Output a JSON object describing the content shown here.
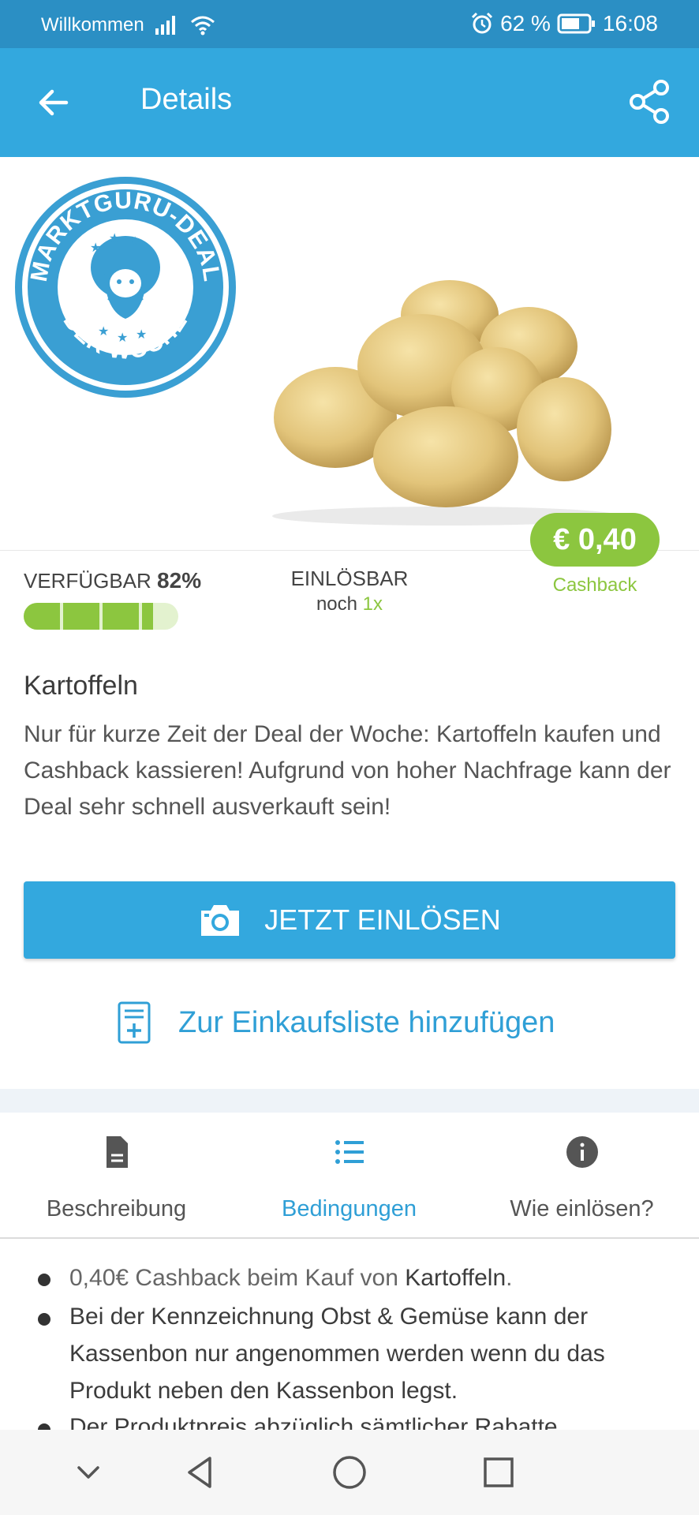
{
  "status_bar": {
    "carrier": "Willkommen",
    "battery": "62 %",
    "time": "16:08"
  },
  "app_bar": {
    "title": "Details"
  },
  "badge": {
    "text_top": "MARKTGURU-DEAL",
    "text_bottom": "DER WOCHE"
  },
  "deal": {
    "price": "€ 0,40",
    "cashback_label": "Cashback",
    "available_label": "VERFÜGBAR",
    "available_value": "82%",
    "available_fraction": 0.82,
    "redeemable_label": "EINLÖSBAR",
    "redeemable_prefix": "noch",
    "redeemable_count": "1x"
  },
  "product": {
    "title": "Kartoffeln",
    "description": "Nur für kurze Zeit der Deal der Woche: Kartoffeln kaufen und Cashback kassieren! Aufgrund von hoher Nachfrage kann der Deal sehr schnell ausverkauft sein!"
  },
  "actions": {
    "redeem_label": "JETZT EINLÖSEN",
    "add_to_list_label": "Zur Einkaufsliste hinzufügen"
  },
  "tabs": [
    {
      "label": "Beschreibung",
      "active": false
    },
    {
      "label": "Bedingungen",
      "active": true
    },
    {
      "label": "Wie einlösen?",
      "active": false
    }
  ],
  "conditions": {
    "item1_prefix": "0,40€ Cashback beim Kauf von ",
    "item1_product": "Kartoffeln",
    "item1_suffix": ".",
    "item2": "Bei der Kennzeichnung  Obst & Gemüse  kann der Kassenbon nur angenommen werden wenn du das Produkt neben den Kassenbon legst.",
    "item3": "Der Produktpreis abzüglich sämtlicher Rabatte"
  },
  "colors": {
    "status_bar": "#2b8fc4",
    "app_bar": "#33a8de",
    "accent_blue": "#2f9fd6",
    "accent_green": "#8cc63f"
  }
}
